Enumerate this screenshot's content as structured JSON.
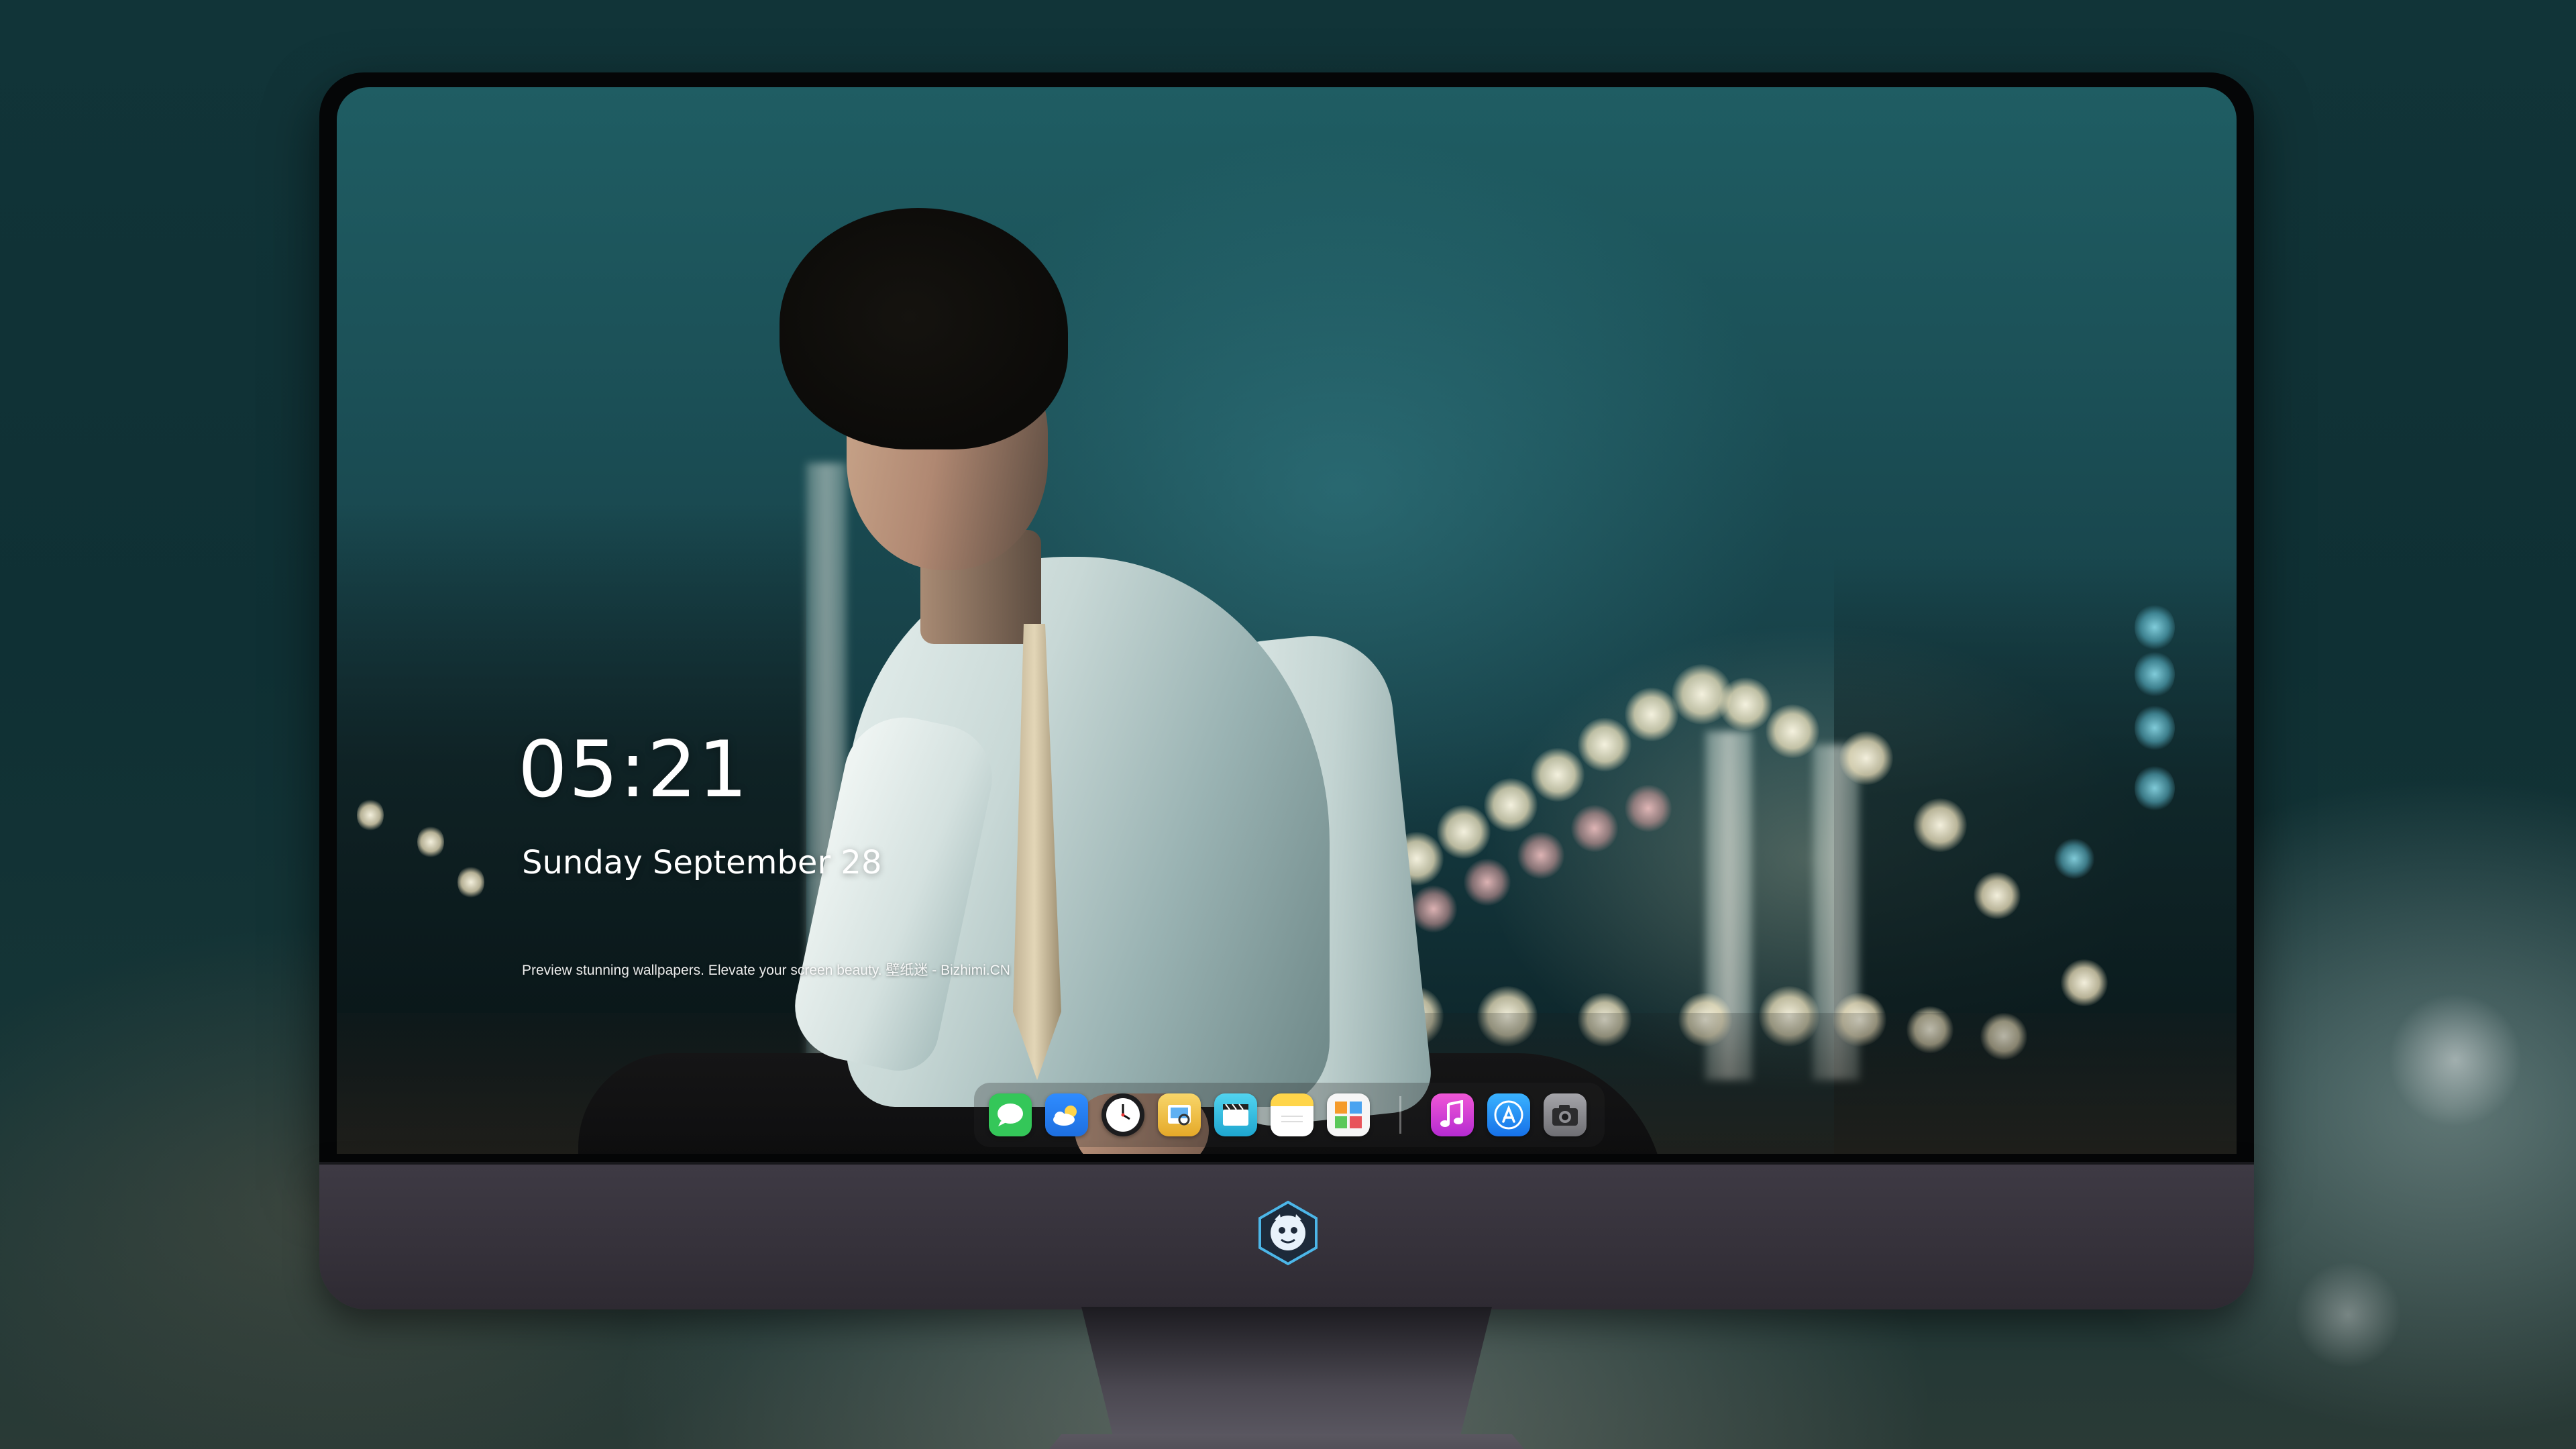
{
  "lockscreen": {
    "time": "05:21",
    "date": "Sunday September  28",
    "caption": "Preview stunning wallpapers. Elevate your screen beauty. 壁纸迷 - Bizhimi.CN"
  },
  "dock": {
    "apps": [
      {
        "name": "messages-icon",
        "color": "#34c759"
      },
      {
        "name": "weather-icon",
        "color": "#2f8cff"
      },
      {
        "name": "clock-icon",
        "color": "#f2f2f2"
      },
      {
        "name": "preview-icon",
        "color": "#f4c542"
      },
      {
        "name": "video-editor-icon",
        "color": "#36c6e8"
      },
      {
        "name": "notes-icon",
        "color": "#ffd54a"
      },
      {
        "name": "photo-gallery-icon",
        "color": "#f6f6f6"
      },
      {
        "name": "music-icon",
        "color": "#d63ad9"
      },
      {
        "name": "app-store-icon",
        "color": "#1e88f5"
      },
      {
        "name": "camera-icon",
        "color": "#8e8e93"
      }
    ]
  },
  "monitor": {
    "logo": "mascot-logo-icon"
  }
}
